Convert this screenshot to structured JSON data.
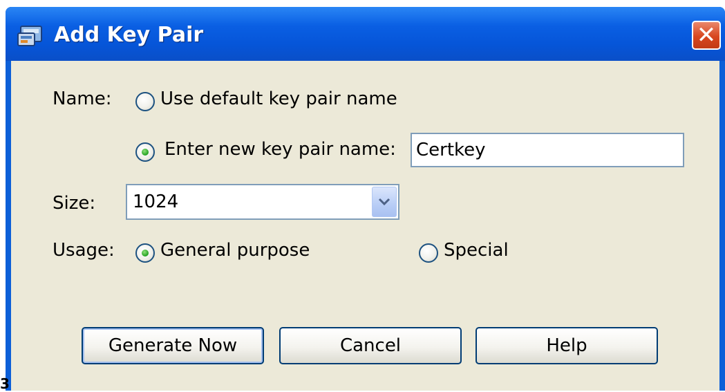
{
  "window": {
    "title": "Add Key Pair",
    "close_symbol": "✕",
    "title_icon": "key-pair-icon"
  },
  "form": {
    "name_label": "Name:",
    "name_option_default": "Use default key pair name",
    "name_option_new": "Enter new key pair name:",
    "name_selected": "new",
    "key_pair_name_value": "Certkey",
    "size_label": "Size:",
    "size_value": "1024",
    "usage_label": "Usage:",
    "usage_option_general": "General purpose",
    "usage_option_special": "Special",
    "usage_selected": "general"
  },
  "buttons": {
    "generate_now": "Generate Now",
    "cancel": "Cancel",
    "help": "Help"
  },
  "stray_text": "3",
  "colors": {
    "titlebar": "#0a5fe3",
    "dialog_background": "#ece9d8",
    "close_button": "#d8461f",
    "radio_dot": "#21a121"
  }
}
